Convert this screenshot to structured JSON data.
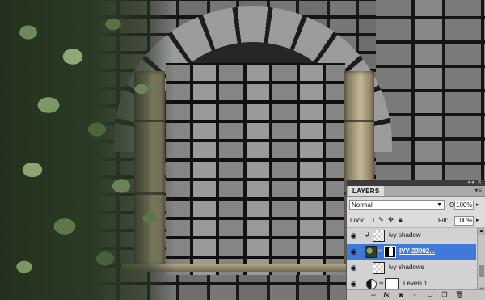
{
  "panel": {
    "tab_label": "LAYERS",
    "topbar_icons": "◂◂ ✕",
    "menu_icon": "▾≡",
    "blend_mode": "Normal",
    "opacity_label": "Opacity:",
    "opacity_value": "100%",
    "lock_label": "Lock:",
    "fill_label": "Fill:",
    "fill_value": "100%"
  },
  "layers": [
    {
      "name": "ivy shadow",
      "visible": true,
      "selected": false,
      "clipped": true
    },
    {
      "name": "IVY-23902...",
      "visible": true,
      "selected": true,
      "has_mask": true
    },
    {
      "name": "ivy shadows",
      "visible": true,
      "selected": false
    },
    {
      "name": "Levels 1",
      "visible": true,
      "selected": false,
      "adjustment": true
    }
  ],
  "icons": {
    "eye": "visibility-eye-icon",
    "link": "chain-link-icon",
    "fx": "fx-icon",
    "mask": "add-mask-icon",
    "adjustment": "adjustment-layer-icon",
    "folder": "new-group-icon",
    "new_layer": "new-layer-icon",
    "trash": "delete-layer-icon"
  },
  "colors": {
    "selected_row": "#3d7ad9",
    "panel_bg": "#dcdcdc"
  }
}
